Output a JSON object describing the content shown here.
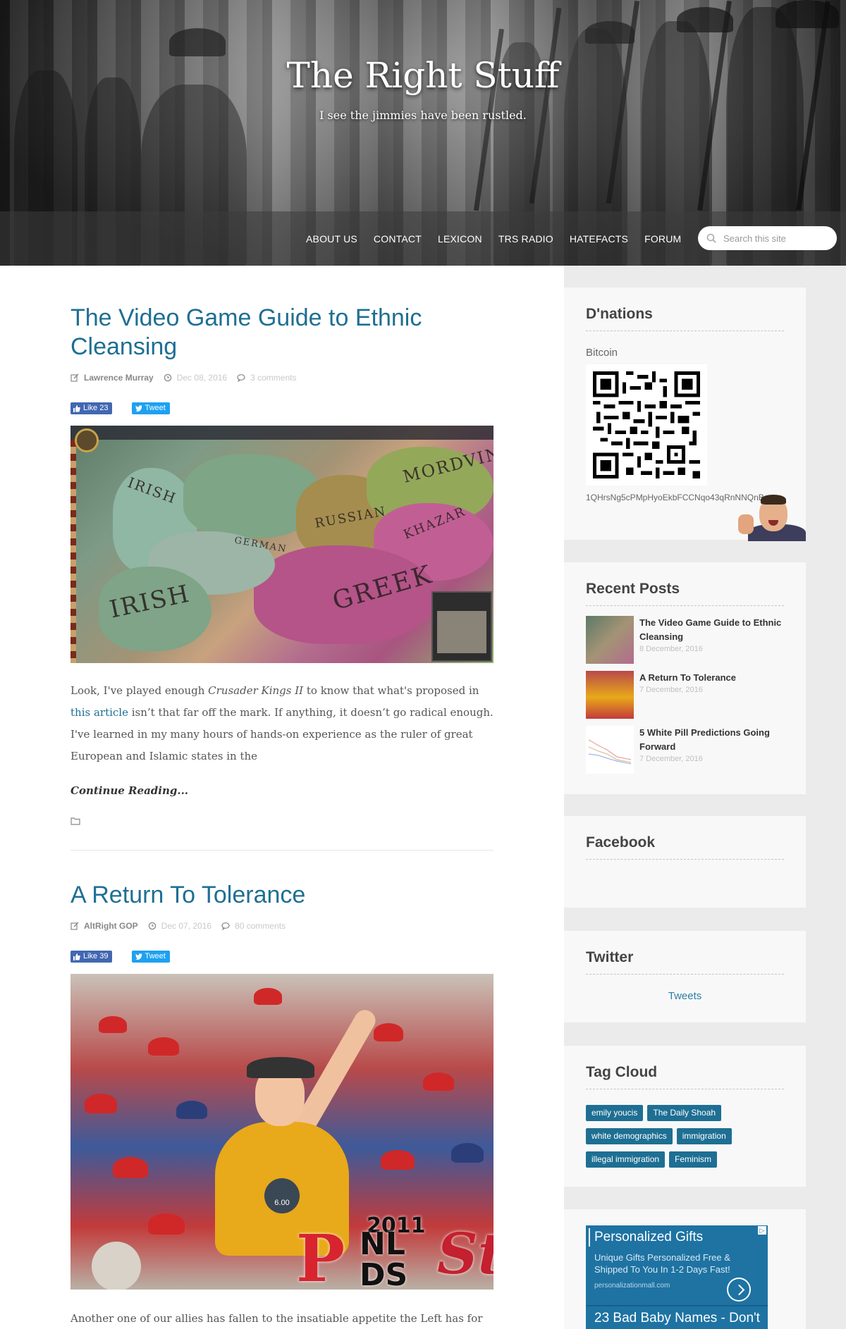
{
  "header": {
    "site_title": "The Right Stuff",
    "tagline": "I see the jimmies have been rustled.",
    "nav": [
      "ABOUT US",
      "CONTACT",
      "LEXICON",
      "TRS RADIO",
      "HATEFACTS",
      "FORUM"
    ],
    "search_placeholder": "Search this site"
  },
  "posts": [
    {
      "title": "The Video Game Guide to Ethnic Cleansing",
      "author": "Lawrence Murray",
      "date": "Dec 08, 2016",
      "comments": "3 comments",
      "like_label": "Like 23",
      "tweet_label": "Tweet",
      "map_labels": [
        "IRISH",
        "IRISH",
        "RUSSIAN",
        "MORDVIN",
        "KHAZAR",
        "GREEK",
        "GERMAN"
      ],
      "excerpt_1": "Look, I've played enough ",
      "excerpt_em": "Crusader Kings II",
      "excerpt_2": " to know that what's proposed in ",
      "excerpt_link": "this article",
      "excerpt_3": " isn’t that far off the mark. If anything, it doesn’t go radical enough. I've learned in my many hours of hands-on experience as the ruler of great European and Islamic states in the",
      "continue_label": "Continue Reading..."
    },
    {
      "title": "A Return To Tolerance",
      "author": "AltRight GOP",
      "date": "Dec 07, 2016",
      "comments": "80 comments",
      "like_label": "Like 39",
      "tweet_label": "Tweet",
      "image_text": {
        "year": "2011",
        "nlds": "NL\nDS",
        "p": "P",
        "stl": "StL",
        "pin": "6.00"
      },
      "excerpt": "Another one of our allies has fallen to the insatiable appetite the Left has for"
    }
  ],
  "sidebar": {
    "donations": {
      "title": "D'nations",
      "bitcoin_label": "Bitcoin",
      "address": "1QHrsNg5cPMpHyoEkbFCCNqo43qRnNNQnB"
    },
    "recent_posts": {
      "title": "Recent Posts",
      "items": [
        {
          "title": "The Video Game Guide to Ethnic Cleansing",
          "date": "8 December, 2016"
        },
        {
          "title": "A Return To Tolerance",
          "date": "7 December, 2016"
        },
        {
          "title": "5 White Pill Predictions Going Forward",
          "date": "7 December, 2016"
        }
      ]
    },
    "facebook": {
      "title": "Facebook"
    },
    "twitter": {
      "title": "Twitter",
      "link": "Tweets"
    },
    "tag_cloud": {
      "title": "Tag Cloud",
      "tags": [
        "emily youcis",
        "The Daily Shoah",
        "white demographics",
        "immigration",
        "illegal immigration",
        "Feminism"
      ]
    },
    "ad": {
      "title": "Personalized Gifts",
      "subtitle": "Unique Gifts Personalized Free & Shipped To You In 1-2 Days Fast!",
      "url": "personalizationmall.com",
      "title2": "23 Bad Baby Names - Don't"
    }
  },
  "colors": {
    "link_blue": "#1e6f93",
    "tag_bg": "#1e6f93",
    "facebook": "#4267b2",
    "twitter": "#1da1f2"
  }
}
